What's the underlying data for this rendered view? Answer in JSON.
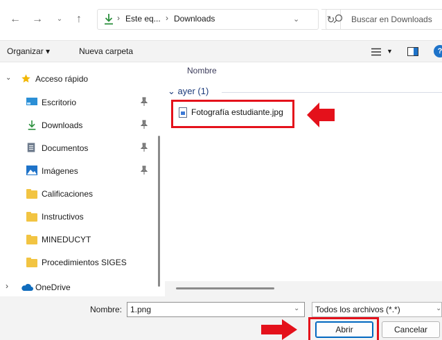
{
  "address_bar": {
    "crumbs": [
      "Este eq...",
      "Downloads"
    ],
    "search_placeholder": "Buscar en Downloads"
  },
  "toolbar": {
    "organize_label": "Organizar ▾",
    "new_folder_label": "Nueva carpeta",
    "help_label": "?"
  },
  "sidebar": {
    "quick_access": "Acceso rápido",
    "items": [
      {
        "label": "Escritorio",
        "icon": "desktop-icon"
      },
      {
        "label": "Downloads",
        "icon": "download-icon"
      },
      {
        "label": "Documentos",
        "icon": "document-icon"
      },
      {
        "label": "Imágenes",
        "icon": "pictures-icon"
      },
      {
        "label": "Calificaciones",
        "icon": "folder-icon"
      },
      {
        "label": "Instructivos",
        "icon": "folder-icon"
      },
      {
        "label": "MINEDUCYT",
        "icon": "folder-icon"
      },
      {
        "label": "Procedimientos SIGES",
        "icon": "folder-icon"
      }
    ],
    "onedrive": "OneDrive"
  },
  "file_list": {
    "column_name": "Nombre",
    "group_label": "ayer (1)",
    "files": [
      {
        "name": "Fotografía estudiante.jpg",
        "icon": "image-file-icon"
      }
    ]
  },
  "footer": {
    "filename_label": "Nombre:",
    "filename_value": "1.png",
    "file_type_filter": "Todos los archivos (*.*)",
    "open_label": "Abrir",
    "cancel_label": "Cancelar"
  },
  "colors": {
    "highlight_red": "#e4111b",
    "accent_blue": "#0067c0",
    "download_green": "#2a8f3c",
    "folder_yellow": "#f2c442",
    "star_gold": "#f2b705"
  }
}
